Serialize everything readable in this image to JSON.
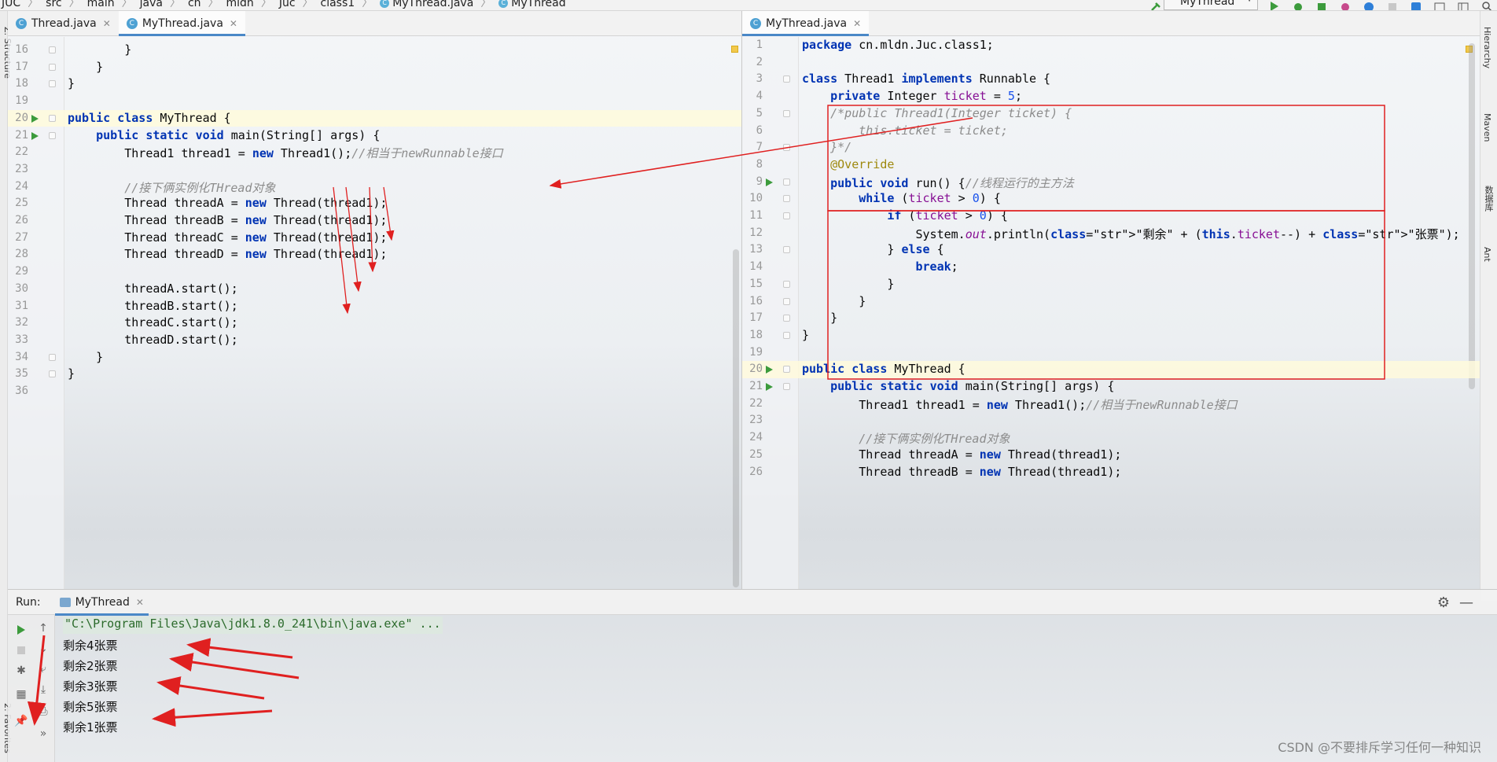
{
  "breadcrumb": {
    "items": [
      "JUC",
      "src",
      "main",
      "java",
      "cn",
      "mldn",
      "Juc",
      "class1",
      "MyThread.java",
      "MyThread"
    ]
  },
  "toolbar": {
    "run_config": "MyThread"
  },
  "left_strip": {
    "label_top": "Z: Structure",
    "label_bottom": "2: Favorites"
  },
  "right_strip": {
    "items": [
      "Hierarchy",
      "Maven",
      "数据库",
      "Ant"
    ]
  },
  "left_editor": {
    "tabs": [
      {
        "label": "Thread.java",
        "active": false
      },
      {
        "label": "MyThread.java",
        "active": true
      }
    ],
    "lines": [
      {
        "n": "16",
        "code": "        }"
      },
      {
        "n": "17",
        "code": "    }"
      },
      {
        "n": "18",
        "code": "}"
      },
      {
        "n": "19",
        "code": ""
      },
      {
        "n": "20",
        "code": "public class MyThread {"
      },
      {
        "n": "21",
        "code": "    public static void main(String[] args) {"
      },
      {
        "n": "22",
        "code": "        Thread1 thread1 = new Thread1();//相当于newRunnable接口"
      },
      {
        "n": "23",
        "code": ""
      },
      {
        "n": "24",
        "code": "        //接下俩实例化THread对象"
      },
      {
        "n": "25",
        "code": "        Thread threadA = new Thread(thread1);"
      },
      {
        "n": "26",
        "code": "        Thread threadB = new Thread(thread1);"
      },
      {
        "n": "27",
        "code": "        Thread threadC = new Thread(thread1);"
      },
      {
        "n": "28",
        "code": "        Thread threadD = new Thread(thread1);"
      },
      {
        "n": "29",
        "code": ""
      },
      {
        "n": "30",
        "code": "        threadA.start();"
      },
      {
        "n": "31",
        "code": "        threadB.start();"
      },
      {
        "n": "32",
        "code": "        threadC.start();"
      },
      {
        "n": "33",
        "code": "        threadD.start();"
      },
      {
        "n": "34",
        "code": "    }"
      },
      {
        "n": "35",
        "code": "}"
      },
      {
        "n": "36",
        "code": ""
      }
    ]
  },
  "right_editor": {
    "tabs": [
      {
        "label": "MyThread.java",
        "active": true
      }
    ],
    "lines": [
      {
        "n": "1",
        "code": "package cn.mldn.Juc.class1;"
      },
      {
        "n": "2",
        "code": ""
      },
      {
        "n": "3",
        "code": "class Thread1 implements Runnable {"
      },
      {
        "n": "4",
        "code": "    private Integer ticket = 5;"
      },
      {
        "n": "5",
        "code": "    /*public Thread1(Integer ticket) {"
      },
      {
        "n": "6",
        "code": "        this.ticket = ticket;"
      },
      {
        "n": "7",
        "code": "    }*/"
      },
      {
        "n": "8",
        "code": "    @Override"
      },
      {
        "n": "9",
        "code": "    public void run() {//线程运行的主方法"
      },
      {
        "n": "10",
        "code": "        while (ticket > 0) {"
      },
      {
        "n": "11",
        "code": "            if (ticket > 0) {"
      },
      {
        "n": "12",
        "code": "                System.out.println(\"剩余\" + (this.ticket--) + \"张票\");"
      },
      {
        "n": "13",
        "code": "            } else {"
      },
      {
        "n": "14",
        "code": "                break;"
      },
      {
        "n": "15",
        "code": "            }"
      },
      {
        "n": "16",
        "code": "        }"
      },
      {
        "n": "17",
        "code": "    }"
      },
      {
        "n": "18",
        "code": "}"
      },
      {
        "n": "19",
        "code": ""
      },
      {
        "n": "20",
        "code": "public class MyThread {"
      },
      {
        "n": "21",
        "code": "    public static void main(String[] args) {"
      },
      {
        "n": "22",
        "code": "        Thread1 thread1 = new Thread1();//相当于newRunnable接口"
      },
      {
        "n": "23",
        "code": ""
      },
      {
        "n": "24",
        "code": "        //接下俩实例化THread对象"
      },
      {
        "n": "25",
        "code": "        Thread threadA = new Thread(thread1);"
      },
      {
        "n": "26",
        "code": "        Thread threadB = new Thread(thread1);"
      }
    ]
  },
  "run_panel": {
    "title": "Run:",
    "tab_label": "MyThread",
    "command": "\"C:\\Program Files\\Java\\jdk1.8.0_241\\bin\\java.exe\" ...",
    "output": [
      "剩余4张票",
      "剩余2张票",
      "剩余3张票",
      "剩余5张票",
      "剩余1张票"
    ]
  },
  "watermark": "CSDN @不要排斥学习任何一种知识",
  "colors": {
    "annotation_red": "#e02020",
    "accent_blue": "#4a88c7",
    "keyword": "#0033b3"
  }
}
